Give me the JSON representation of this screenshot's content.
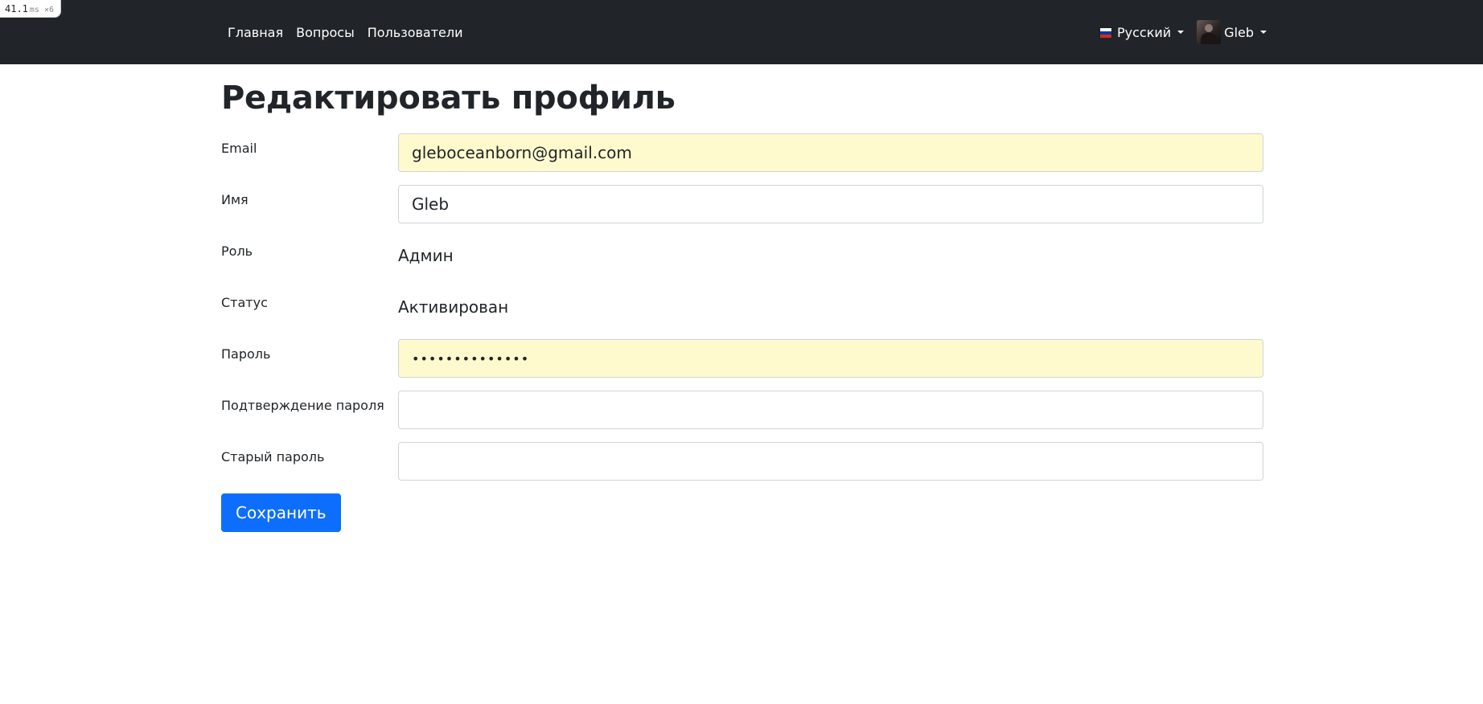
{
  "debug_badge": {
    "value": "41.1",
    "unit": "ms ×6"
  },
  "navbar": {
    "links": [
      "Главная",
      "Вопросы",
      "Пользователи"
    ],
    "language": {
      "label": "Русский",
      "flag_icon": "ru-flag-icon"
    },
    "user": {
      "name": "Gleb",
      "avatar_icon": "user-avatar-icon"
    }
  },
  "page": {
    "title": "Редактировать профиль"
  },
  "form": {
    "email": {
      "label": "Email",
      "value": "gleboceanborn@gmail.com"
    },
    "name": {
      "label": "Имя",
      "value": "Gleb"
    },
    "role": {
      "label": "Роль",
      "value": "Админ"
    },
    "status": {
      "label": "Статус",
      "value": "Активирован"
    },
    "password": {
      "label": "Пароль",
      "value": "••••••••••••••"
    },
    "password_confirm": {
      "label": "Подтверждение пароля",
      "value": ""
    },
    "old_password": {
      "label": "Старый пароль",
      "value": ""
    },
    "submit_label": "Сохранить"
  },
  "colors": {
    "navbar_bg": "#212529",
    "autofill_bg": "#fffacd",
    "primary": "#0d6efd"
  }
}
